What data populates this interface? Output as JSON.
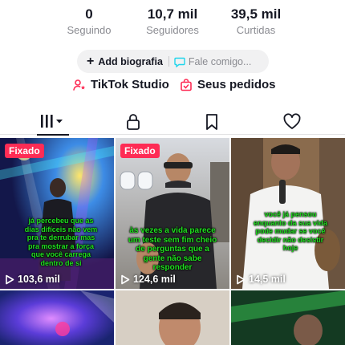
{
  "stats": [
    {
      "value": "0",
      "label": "Seguindo"
    },
    {
      "value": "10,7 mil",
      "label": "Seguidores"
    },
    {
      "value": "39,5 mil",
      "label": "Curtidas"
    }
  ],
  "bio": {
    "add_label": "Add biografia",
    "contact_label": "Fale comigo..."
  },
  "links": {
    "studio": "TikTok Studio",
    "orders": "Seus pedidos"
  },
  "tabs": [
    "videos-grid",
    "private-lock",
    "saved-bookmark",
    "liked-heart"
  ],
  "colors": {
    "accent": "#fe2c55",
    "caption_green": "#1fe11f",
    "contact_blue": "#20d5ec"
  },
  "videos": [
    {
      "pinned": "Fixado",
      "caption": "já percebeu que as dias difíceis não vem pra te derrubar mas pra mostrar a força que você carrega dentro de si",
      "views": "103,6 mil"
    },
    {
      "pinned": "Fixado",
      "caption": "às vezes a vida parece um teste sem fim cheio de perguntas que a gente não sabe responder",
      "views": "124,6 mil"
    },
    {
      "pinned": "",
      "caption": "você já pensou enquanto da sua vida pode mudar se você decidir não desistir hoje",
      "views": "14,5 mil"
    },
    {
      "pinned": "",
      "caption": "",
      "views": ""
    },
    {
      "pinned": "",
      "caption": "",
      "views": ""
    },
    {
      "pinned": "",
      "caption": "",
      "views": ""
    }
  ]
}
